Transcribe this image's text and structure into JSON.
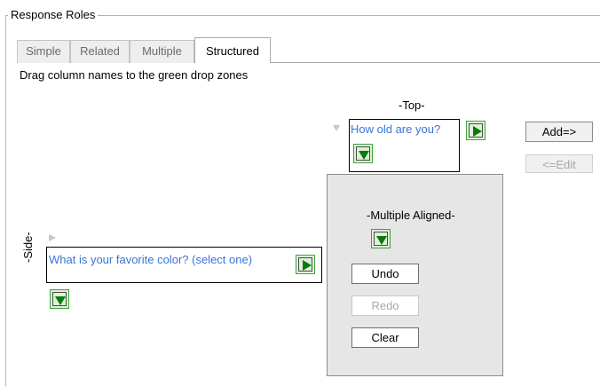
{
  "group": {
    "title": "Response Roles"
  },
  "tabs": [
    {
      "label": "Simple",
      "active": false
    },
    {
      "label": "Related",
      "active": false
    },
    {
      "label": "Multiple",
      "active": false
    },
    {
      "label": "Structured",
      "active": true
    }
  ],
  "instructions": "Drag column names to the green drop zones",
  "top_zone": {
    "label": "-Top-",
    "column": "How old are you?"
  },
  "side_zone": {
    "label": "-Side-",
    "column": "What is your favorite color? (select one)"
  },
  "center_panel": {
    "label": "-Multiple Aligned-",
    "buttons": {
      "undo": "Undo",
      "redo": "Redo",
      "clear": "Clear"
    }
  },
  "actions": {
    "add": "Add=>",
    "edit": "<=Edit"
  },
  "colors": {
    "column_text": "#3b73d8",
    "drop_zone_green": "#0b7a0b",
    "panel_background": "#e6e6e6"
  },
  "icons": {
    "drop_right": "green-triangle-right-icon",
    "drop_down": "green-triangle-down-icon"
  }
}
